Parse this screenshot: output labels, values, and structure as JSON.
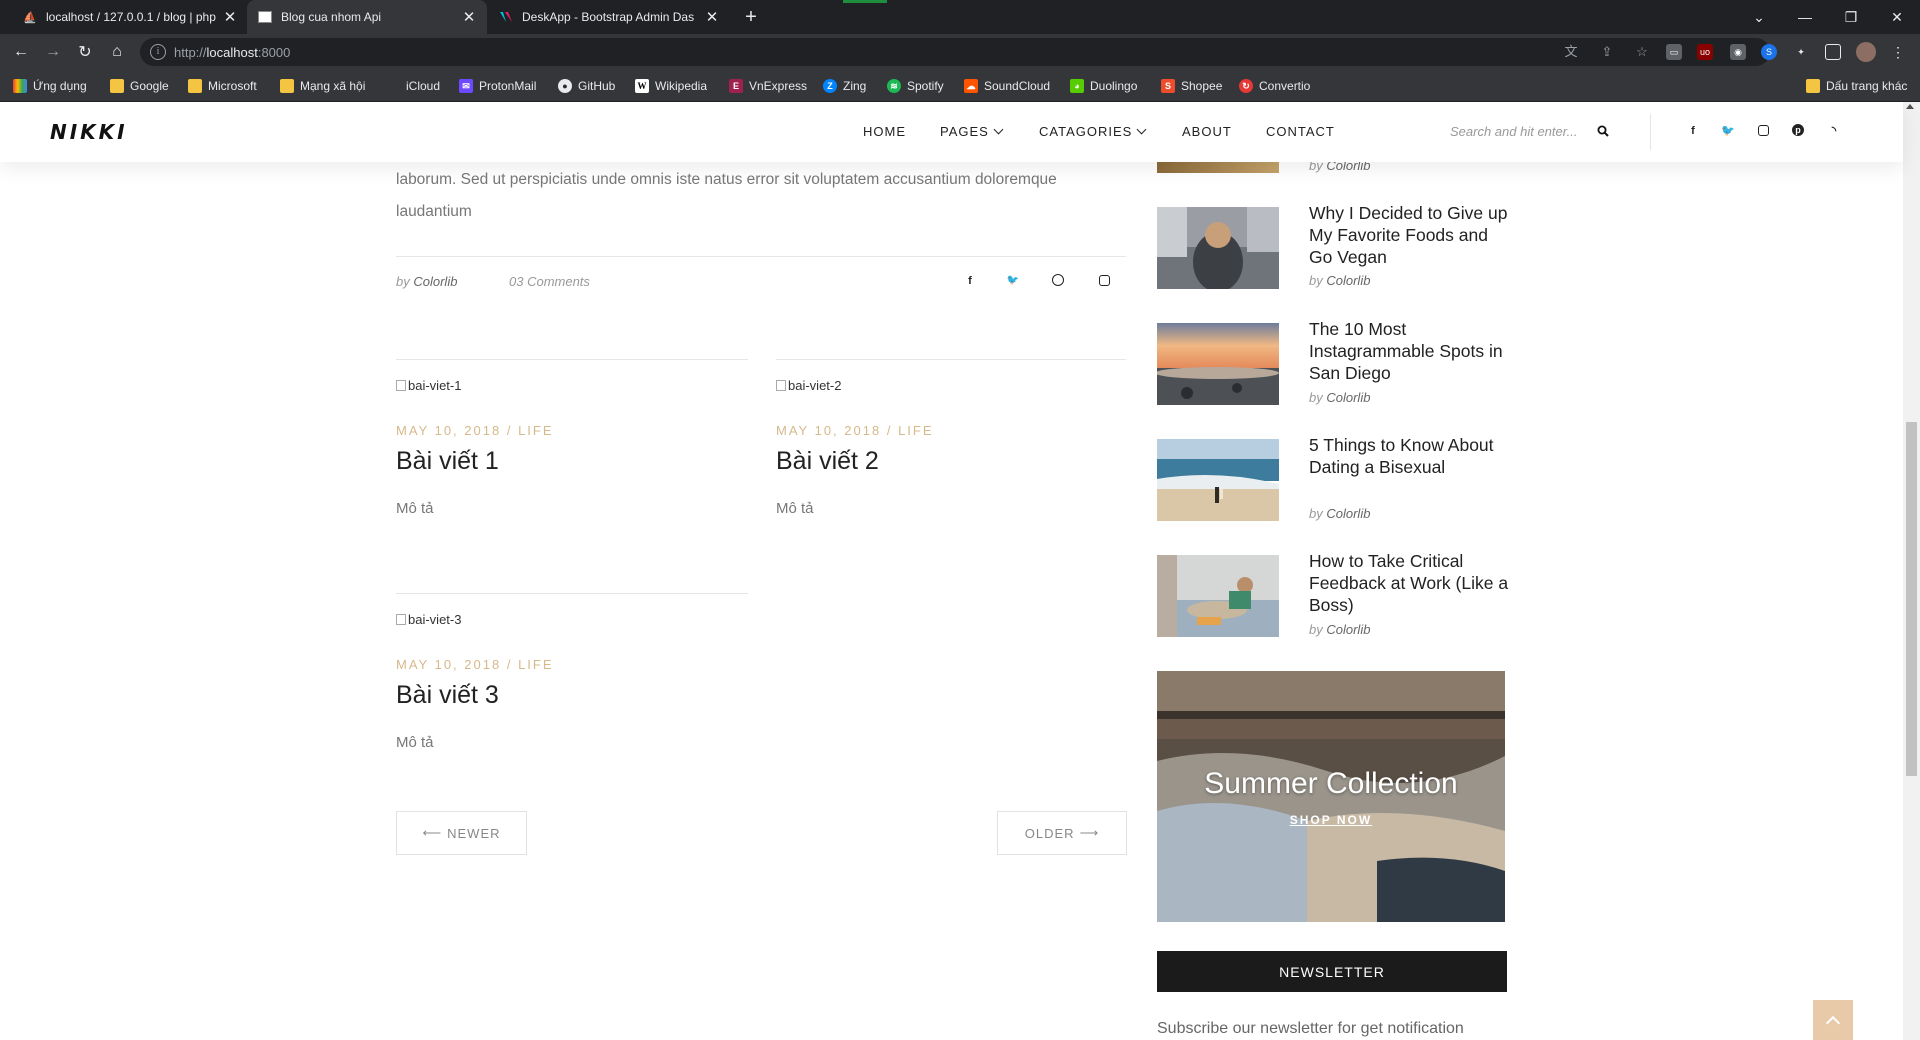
{
  "browser": {
    "tabs": [
      {
        "title": "localhost / 127.0.0.1 / blog | php",
        "icon": "phpmyadmin-icon"
      },
      {
        "title": "Blog cua nhom Api",
        "icon": "site-favicon-icon"
      },
      {
        "title": "DeskApp - Bootstrap Admin Das",
        "icon": "deskapp-icon"
      }
    ],
    "url_host": "localhost",
    "url_rest": ":8000",
    "url_prefix": "http://",
    "bookmarks": [
      {
        "label": "Ứng dụng",
        "icon": "apps-grid-icon",
        "color": "#ea4335"
      },
      {
        "label": "Google",
        "icon": "folder-icon",
        "color": "#f4c542"
      },
      {
        "label": "Microsoft",
        "icon": "folder-icon",
        "color": "#f4c542"
      },
      {
        "label": "Mạng xã hội",
        "icon": "folder-icon",
        "color": "#f4c542"
      },
      {
        "label": "iCloud",
        "icon": "apple-icon",
        "color": "#9aa0a6"
      },
      {
        "label": "ProtonMail",
        "icon": "protonmail-icon",
        "color": "#6d4aff"
      },
      {
        "label": "GitHub",
        "icon": "github-icon",
        "color": "#24292e"
      },
      {
        "label": "Wikipedia",
        "icon": "wikipedia-icon",
        "color": "#ffffff"
      },
      {
        "label": "VnExpress",
        "icon": "vnexpress-icon",
        "color": "#9f224e"
      },
      {
        "label": "Zing",
        "icon": "zing-icon",
        "color": "#0085ff"
      },
      {
        "label": "Spotify",
        "icon": "spotify-icon",
        "color": "#1db954"
      },
      {
        "label": "SoundCloud",
        "icon": "soundcloud-icon",
        "color": "#ff5500"
      },
      {
        "label": "Duolingo",
        "icon": "duolingo-icon",
        "color": "#58cc02"
      },
      {
        "label": "Shopee",
        "icon": "shopee-icon",
        "color": "#ee4d2d"
      },
      {
        "label": "Convertio",
        "icon": "convertio-icon",
        "color": "#e53935"
      }
    ],
    "other_bookmarks": "Dấu trang khác"
  },
  "site": {
    "logo": "NIKKI",
    "menu": {
      "home": "HOME",
      "pages": "PAGES",
      "categories": "CATAGORIES",
      "about": "ABOUT",
      "contact": "CONTACT"
    },
    "search_placeholder": "Search and hit enter...",
    "accent_color": "#d6b98b"
  },
  "article": {
    "text_line1": "laborum. Sed ut perspiciatis unde omnis iste natus error sit voluptatem accusantium doloremque",
    "text_line2": "laudantium",
    "by": "by",
    "author": "Colorlib",
    "comments": "03 Comments"
  },
  "posts": [
    {
      "image_alt": "bai-viet-1",
      "date": "MAY 10, 2018",
      "sep": "/",
      "category": "LIFE",
      "title": "Bài viết 1",
      "desc": "Mô tả"
    },
    {
      "image_alt": "bai-viet-2",
      "date": "MAY 10, 2018",
      "sep": "/",
      "category": "LIFE",
      "title": "Bài viết 2",
      "desc": "Mô tả"
    },
    {
      "image_alt": "bai-viet-3",
      "date": "MAY 10, 2018",
      "sep": "/",
      "category": "LIFE",
      "title": "Bài viết 3",
      "desc": "Mô tả"
    }
  ],
  "pagination": {
    "newer": "NEWER",
    "older": "OLDER"
  },
  "sidebar": {
    "by": "by",
    "top_author": "Colorlib",
    "popular": [
      {
        "title": "Why I Decided to Give up My Favorite Foods and Go Vegan",
        "author": "Colorlib"
      },
      {
        "title": "The 10 Most Instagrammable Spots in San Diego",
        "author": "Colorlib"
      },
      {
        "title": "5 Things to Know About Dating a Bisexual",
        "author": "Colorlib"
      },
      {
        "title": "How to Take Critical Feedback at Work (Like a Boss)",
        "author": "Colorlib"
      }
    ],
    "banner_title": "Summer Collection",
    "banner_link": "SHOP NOW",
    "newsletter_label": "NEWSLETTER",
    "subscribe_text": "Subscribe our newsletter for get notification"
  }
}
